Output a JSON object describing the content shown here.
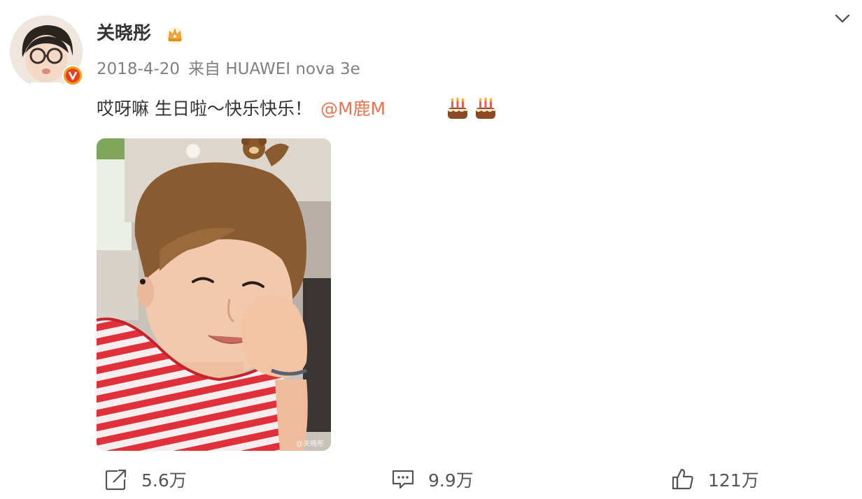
{
  "post": {
    "author": "关晓彤",
    "date": "2018-4-20",
    "source": "来自 HUAWEI nova 3e",
    "text": "哎呀嘛 生日啦～快乐快乐！",
    "mention": "@M鹿M",
    "emojis": [
      "cake-icon",
      "cake-icon"
    ],
    "photo_watermark": "@关晓彤"
  },
  "actions": {
    "repost_count": "5.6万",
    "comment_count": "9.9万",
    "like_count": "121万"
  },
  "icons": {
    "avatar": "avatar",
    "verified": "verified-v-icon",
    "crown": "crown-icon",
    "collapse": "chevron-down-icon",
    "repost": "repost-icon",
    "comment": "comment-icon",
    "like": "thumbs-up-icon"
  },
  "colors": {
    "mention": "#eb7350",
    "verified_badge": "#f0a020",
    "text_primary": "#333333",
    "text_secondary": "#808080"
  }
}
